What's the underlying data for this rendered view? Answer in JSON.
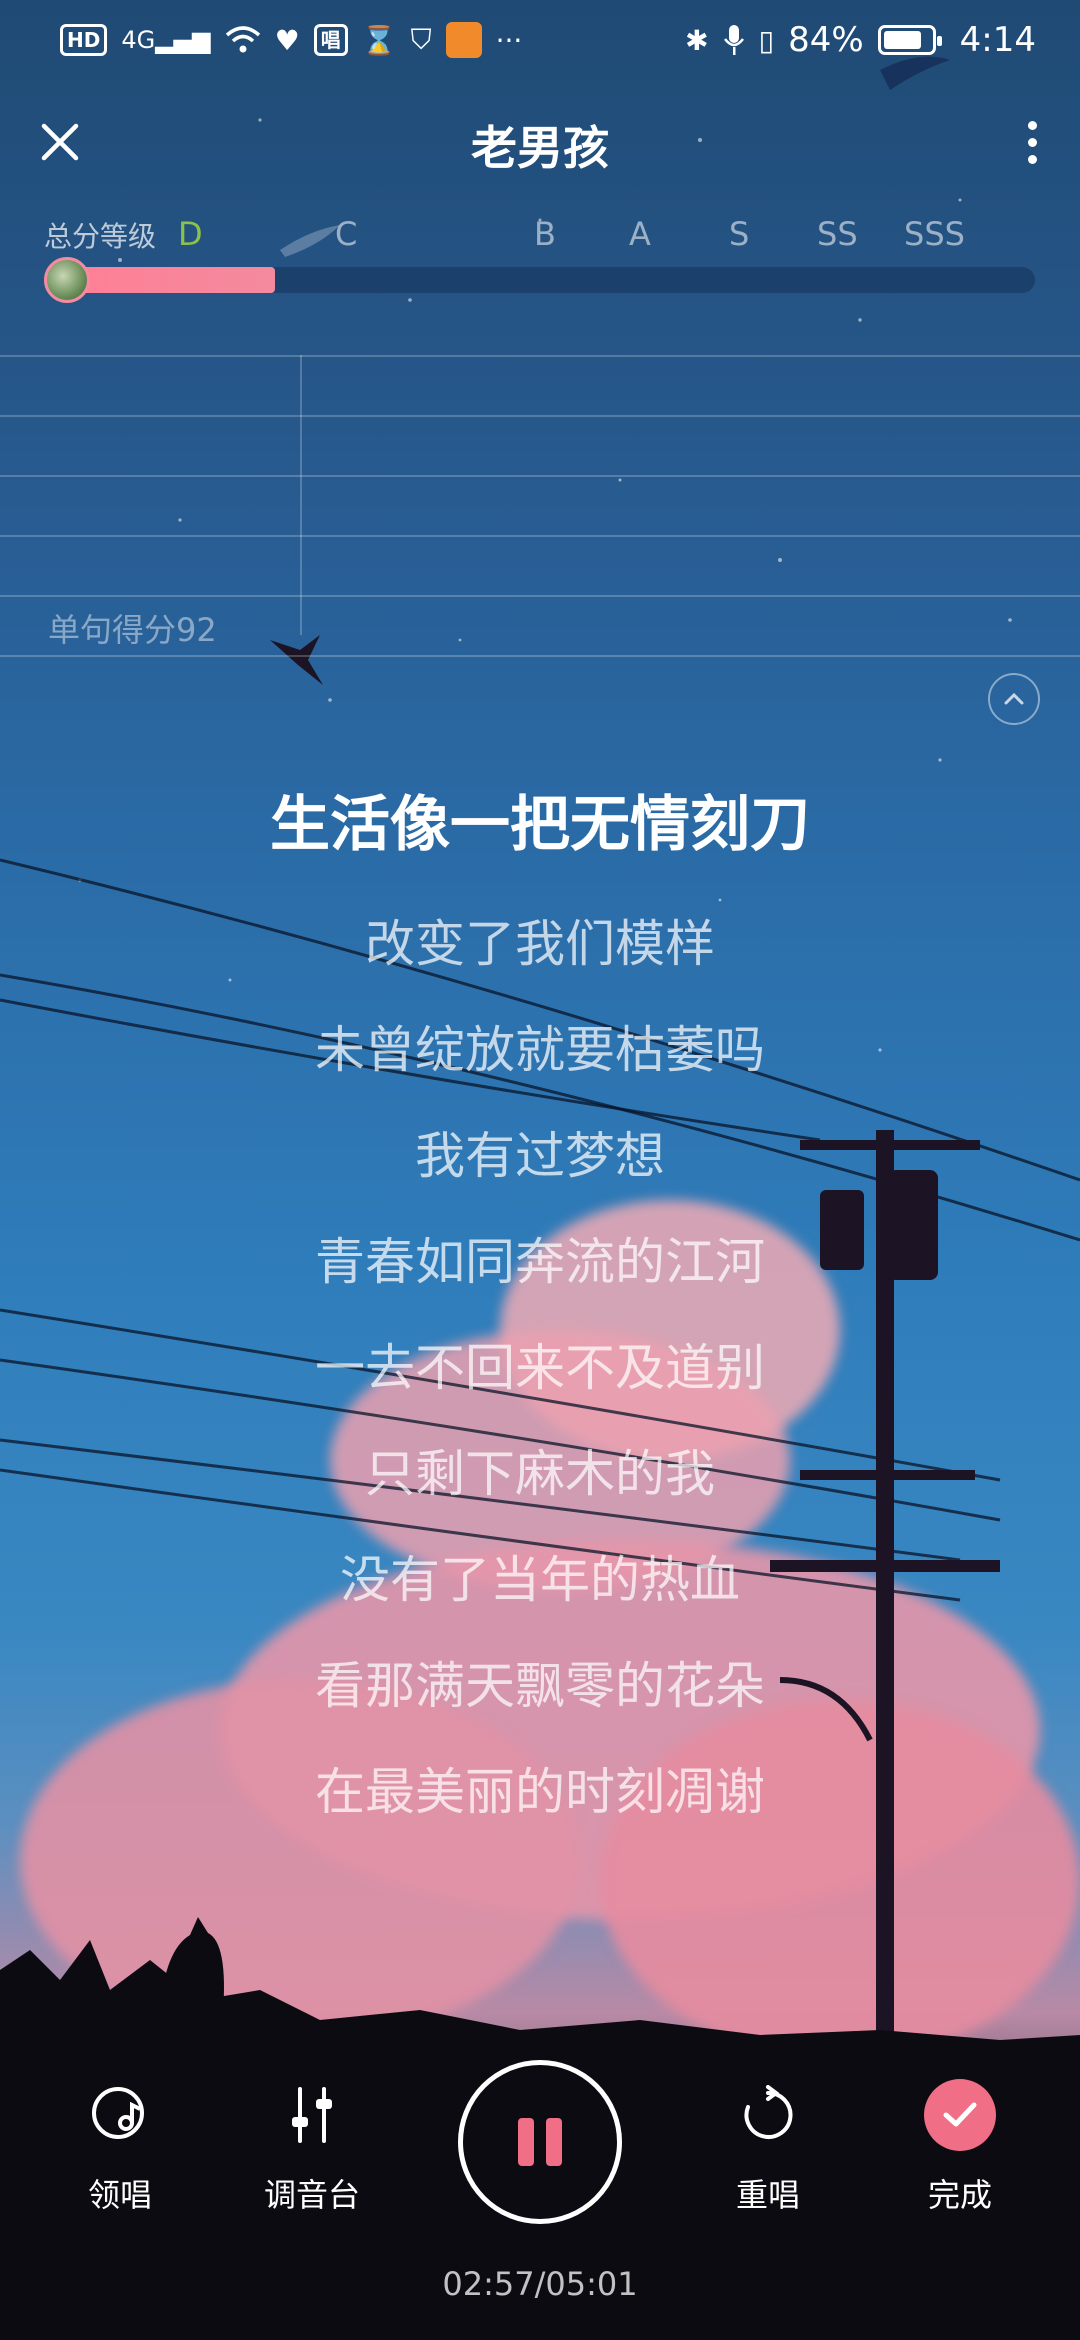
{
  "status_bar": {
    "network": "4G",
    "hd": "HD",
    "sing_badge": "唱",
    "battery": "84%",
    "battery_level": 0.84,
    "time": "4:14",
    "more": "···"
  },
  "header": {
    "title": "老男孩"
  },
  "score": {
    "label": "总分等级",
    "current_grade": "D",
    "grades": [
      "C",
      "B",
      "A",
      "S",
      "SS",
      "SSS"
    ],
    "progress": 0.22
  },
  "pitch": {
    "line_score": "单句得分92"
  },
  "lyrics": {
    "current": "生活像一把无情刻刀",
    "lines": [
      "改变了我们模样",
      "未曾绽放就要枯萎吗",
      "我有过梦想",
      "青春如同奔流的江河",
      "一去不回来不及道别",
      "只剩下麻木的我",
      "没有了当年的热血",
      "看那满天飘零的花朵",
      "在最美丽的时刻凋谢"
    ]
  },
  "controls": {
    "lead_vocal": "领唱",
    "mixer": "调音台",
    "resing": "重唱",
    "done": "完成",
    "time": "02:57/05:01"
  },
  "colors": {
    "accent": "#f06e86",
    "grade_current": "#8bc34a"
  }
}
